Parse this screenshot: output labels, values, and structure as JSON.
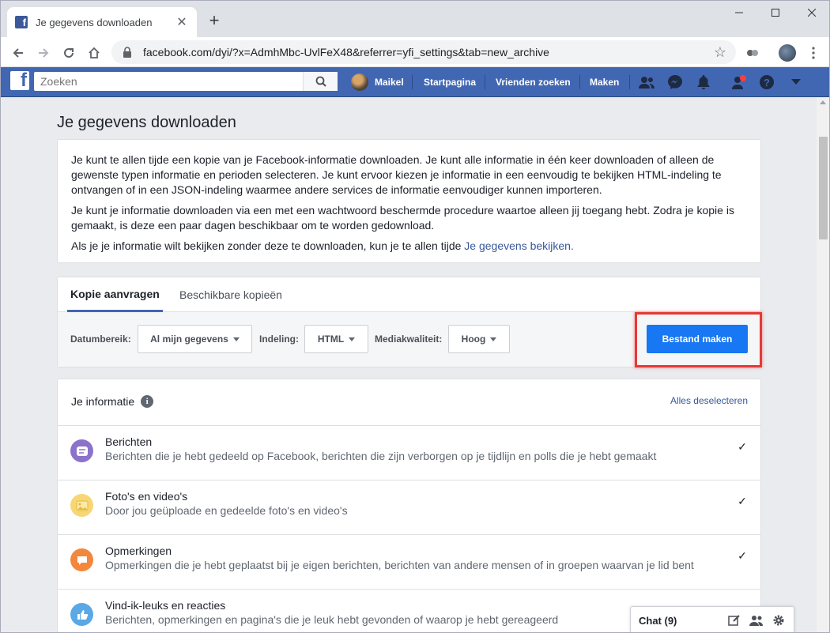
{
  "browser": {
    "tab_title": "Je gegevens downloaden",
    "tab_close": "✕",
    "new_tab": "+",
    "url": "facebook.com/dyi/?x=AdmhMbc-UvlFeX48&referrer=yfi_settings&tab=new_archive"
  },
  "fbbar": {
    "logo": "f",
    "search_placeholder": "Zoeken",
    "profile_name": "Maikel",
    "nav": [
      "Startpagina",
      "Vrienden zoeken",
      "Maken"
    ]
  },
  "page": {
    "title": "Je gegevens downloaden",
    "intro_p1": "Je kunt te allen tijde een kopie van je Facebook-informatie downloaden. Je kunt alle informatie in één keer downloaden of alleen de gewenste typen informatie en perioden selecteren. Je kunt ervoor kiezen je informatie in een eenvoudig te bekijken HTML-indeling te ontvangen of in een JSON-indeling waarmee andere services de informatie eenvoudiger kunnen importeren.",
    "intro_p2": "Je kunt je informatie downloaden via een met een wachtwoord beschermde procedure waartoe alleen jij toegang hebt. Zodra je kopie is gemaakt, is deze een paar dagen beschikbaar om te worden gedownload.",
    "intro_p3_text": "Als je je informatie wilt bekijken zonder deze te downloaden, kun je te allen tijde ",
    "intro_p3_link": "Je gegevens bekijken."
  },
  "request": {
    "tabs": [
      "Kopie aanvragen",
      "Beschikbare kopieën"
    ],
    "date_label": "Datumbereik:",
    "date_value": "Al mijn gegevens",
    "format_label": "Indeling:",
    "format_value": "HTML",
    "quality_label": "Mediakwaliteit:",
    "quality_value": "Hoog",
    "create_button": "Bestand maken"
  },
  "info": {
    "heading": "Je informatie",
    "deselect_all": "Alles deselecteren",
    "items": [
      {
        "title": "Berichten",
        "description": "Berichten die je hebt gedeeld op Facebook, berichten die zijn verborgen op je tijdlijn en polls die je hebt gemaakt",
        "checked": true,
        "icon": "posts-icon",
        "color": "#8c72cb"
      },
      {
        "title": "Foto's en video's",
        "description": "Door jou geüploade en gedeelde foto's en video's",
        "checked": true,
        "icon": "photos-icon",
        "color": "#f7d775"
      },
      {
        "title": "Opmerkingen",
        "description": "Opmerkingen die je hebt geplaatst bij je eigen berichten, berichten van andere mensen of in groepen waarvan je lid bent",
        "checked": true,
        "icon": "comments-icon",
        "color": "#f3873b"
      },
      {
        "title": "Vind-ik-leuks en reacties",
        "description": "Berichten, opmerkingen en pagina's die je leuk hebt gevonden of waarop je hebt gereageerd",
        "checked": false,
        "icon": "likes-icon",
        "color": "#5aa8e6"
      }
    ]
  },
  "chat": {
    "label": "Chat (9)"
  },
  "colors": {
    "fb_blue": "#4267b2",
    "primary_button": "#1877f2",
    "highlight": "#e53935",
    "notification_dot": "#fa3e3e"
  }
}
